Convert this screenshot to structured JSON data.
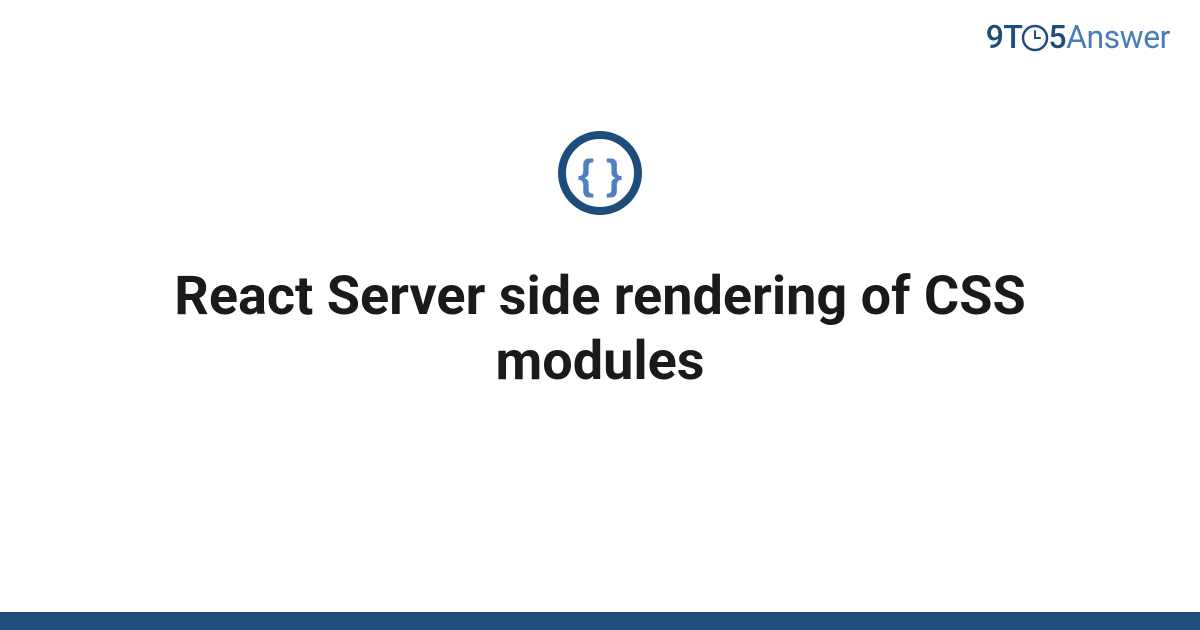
{
  "brand": {
    "part1": "9",
    "part2": "T",
    "part4": "5",
    "part5": "Answer"
  },
  "title": "React Server side rendering of CSS modules",
  "colors": {
    "dark_blue": "#1d4d7a",
    "light_blue": "#4a7db8",
    "braces_blue": "#4f80c0"
  }
}
